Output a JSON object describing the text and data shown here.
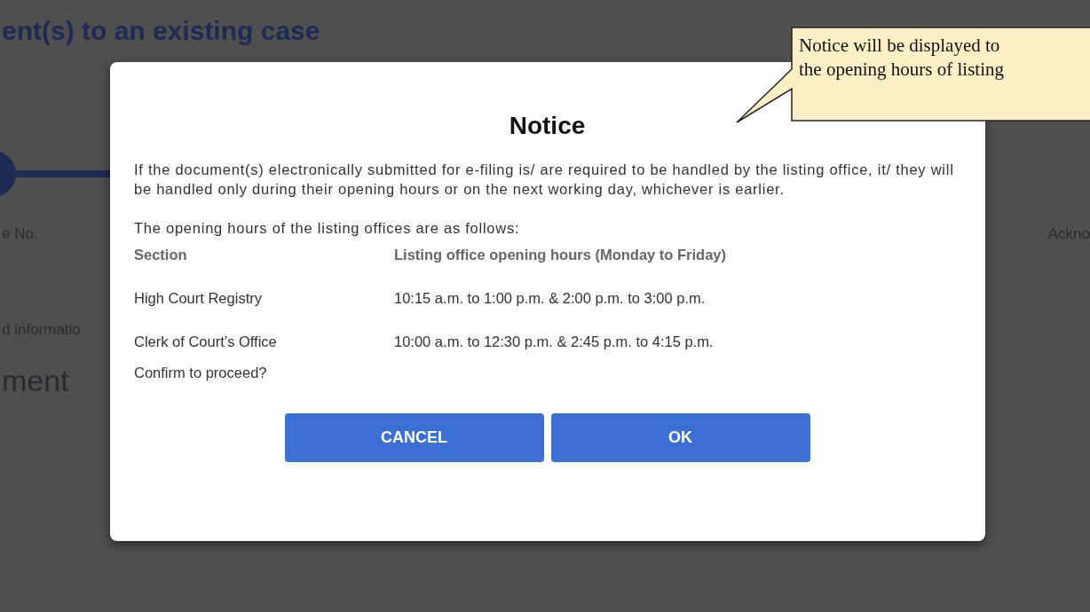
{
  "page": {
    "title": "ent(s) to an existing case",
    "steps": [
      {
        "label": "e No."
      },
      {
        "label": "Ackno"
      }
    ],
    "section_label": "d informatio",
    "heading": "ment"
  },
  "dialog": {
    "title": "Notice",
    "paragraphs": [
      "If the document(s) electronically submitted for e-filing is/ are required to be handled by the listing office, it/ they will be handled only during their opening hours or on the next working day, whichever is earlier.",
      "The opening hours of the listing offices are as follows:"
    ],
    "table": {
      "columns": [
        "Section",
        "Listing office opening hours (Monday to Friday)"
      ],
      "rows": [
        [
          "High Court Registry",
          "10:15 a.m. to 1:00 p.m. & 2:00 p.m. to 3:00 p.m."
        ],
        [
          "Clerk of Court’s Office",
          "10:00 a.m. to 12:30 p.m. & 2:45 p.m. to 4:15 p.m."
        ]
      ]
    },
    "prompt": "Confirm to proceed?",
    "buttons": [
      {
        "label": "CANCEL"
      },
      {
        "label": "OK"
      }
    ]
  },
  "callout": {
    "lines": [
      "Notice will be displayed to",
      "the opening hours of listing"
    ]
  }
}
